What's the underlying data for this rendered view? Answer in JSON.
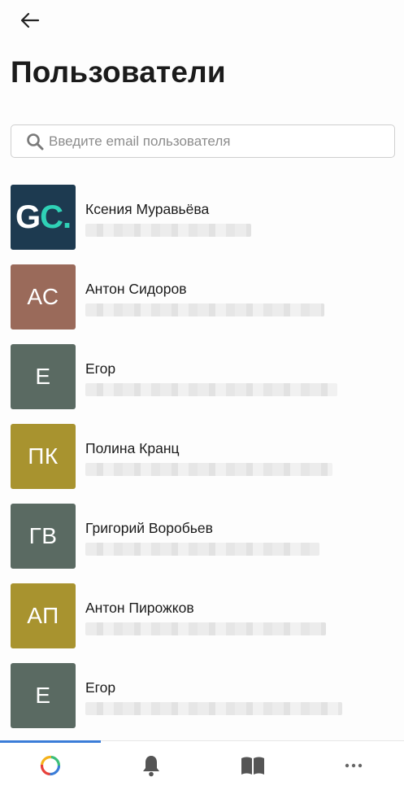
{
  "header": {
    "back_icon": "arrow-left-icon",
    "title": "Пользователи"
  },
  "search": {
    "icon": "search-icon",
    "placeholder": "Введите email пользователя",
    "value": ""
  },
  "users": [
    {
      "name": "Ксения Муравьёва",
      "avatar_text": "GC",
      "avatar_color": "#1d3a50",
      "avatar_type": "logo",
      "email_redacted": true
    },
    {
      "name": "Антон Сидоров",
      "avatar_text": "АС",
      "avatar_color": "#9a6a5a",
      "email_redacted": true
    },
    {
      "name": "Егор",
      "avatar_text": "Е",
      "avatar_color": "#5a6a62",
      "email_redacted": true
    },
    {
      "name": "Полина Кранц",
      "avatar_text": "ПК",
      "avatar_color": "#a8932f",
      "email_redacted": true
    },
    {
      "name": "Григорий Воробьев",
      "avatar_text": "ГВ",
      "avatar_color": "#5a6a62",
      "email_redacted": true
    },
    {
      "name": "Антон Пирожков",
      "avatar_text": "АП",
      "avatar_color": "#a8932f",
      "email_redacted": true
    },
    {
      "name": "Егор",
      "avatar_text": "Е",
      "avatar_color": "#5a6a62",
      "email_redacted": true
    }
  ],
  "bottom_nav": {
    "active_index": 0,
    "accent_color": "#3b7dd8",
    "items": [
      {
        "icon": "app-logo-icon"
      },
      {
        "icon": "bell-icon"
      },
      {
        "icon": "book-icon"
      },
      {
        "icon": "more-icon"
      }
    ]
  }
}
